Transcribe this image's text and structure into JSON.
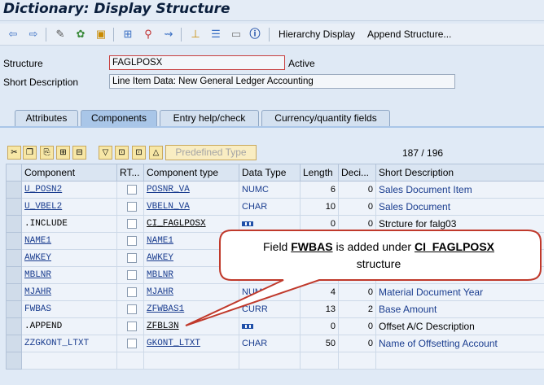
{
  "window": {
    "title": "Dictionary: Display Structure"
  },
  "toolbar": {
    "icons": [
      "back-arrow-icon",
      "forward-arrow-icon",
      "edit-glasses-icon",
      "display-change-icon",
      "activate-icon",
      "where-used-icon",
      "object-list-icon",
      "wand-icon",
      "transport-icon",
      "hierarchy-icon",
      "stack-icon",
      "technical-settings-icon",
      "info-icon"
    ],
    "hierarchy_display": "Hierarchy Display",
    "append_structure": "Append Structure..."
  },
  "header": {
    "structure_label": "Structure",
    "structure_value": "FAGLPOSX",
    "status": "Active",
    "short_desc_label": "Short Description",
    "short_desc_value": "Line Item Data: New General Ledger Accounting"
  },
  "tabs": [
    {
      "label": "Attributes",
      "active": false
    },
    {
      "label": "Components",
      "active": true
    },
    {
      "label": "Entry help/check",
      "active": false
    },
    {
      "label": "Currency/quantity fields",
      "active": false
    }
  ],
  "table_toolbar": {
    "predefined_type": "Predefined Type",
    "counter": "187 / 196"
  },
  "columns": [
    "Component",
    "RT...",
    "Component type",
    "Data Type",
    "Length",
    "Deci...",
    "Short Description"
  ],
  "rows": [
    {
      "component": "U_POSN2",
      "ctype": "POSNR_VA",
      "dtype": "NUMC",
      "length": "6",
      "deci": "0",
      "desc": "Sales Document Item"
    },
    {
      "component": "U_VBEL2",
      "ctype": "VBELN_VA",
      "dtype": "CHAR",
      "length": "10",
      "deci": "0",
      "desc": "Sales Document"
    },
    {
      "component": ".INCLUDE",
      "ctype": "CI_FAGLPOSX",
      "dtype": "",
      "length": "0",
      "deci": "0",
      "desc": "Strcture for falg03"
    },
    {
      "component": "NAME1",
      "ctype": "NAME1",
      "dtype": "",
      "length": "",
      "deci": "",
      "desc": ""
    },
    {
      "component": "AWKEY",
      "ctype": "AWKEY",
      "dtype": "",
      "length": "",
      "deci": "",
      "desc": ""
    },
    {
      "component": "MBLNR",
      "ctype": "MBLNR",
      "dtype": "",
      "length": "",
      "deci": "",
      "desc": ""
    },
    {
      "component": "MJAHR",
      "ctype": "MJAHR",
      "dtype": "NUMC",
      "length": "4",
      "deci": "0",
      "desc": "Material Document Year"
    },
    {
      "component": "FWBAS",
      "ctype": "ZFWBAS1",
      "dtype": "CURR",
      "length": "13",
      "deci": "2",
      "desc": "Base Amount"
    },
    {
      "component": ".APPEND",
      "ctype": "ZFBL3N",
      "dtype": "",
      "length": "0",
      "deci": "0",
      "desc": "Offset A/C Description"
    },
    {
      "component": "ZZGKONT_LTXT",
      "ctype": "GKONT_LTXT",
      "dtype": "CHAR",
      "length": "50",
      "deci": "0",
      "desc": "Name of Offsetting Account"
    }
  ],
  "callout": {
    "prefix": "Field ",
    "field": "FWBAS",
    "middle": " is added under ",
    "structure": "CI_FAGLPOSX",
    "suffix": "structure"
  },
  "colors": {
    "accent": "#1a3d8f",
    "title": "#0a1e3c",
    "callout_border": "#c0392b"
  }
}
